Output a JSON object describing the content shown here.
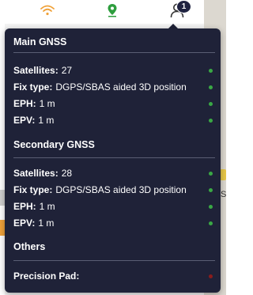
{
  "topbar": {
    "icons": {
      "wifi": "wifi-icon",
      "gps": "map-pin-icon",
      "user": "user-icon"
    },
    "notification_count": "1",
    "colors": {
      "wifi": "#f0a23a",
      "gps": "#2e9e3e"
    }
  },
  "popup": {
    "main_gnss": {
      "title": "Main GNSS",
      "rows": [
        {
          "label": "Satellites:",
          "value": "27",
          "status": "green"
        },
        {
          "label": "Fix type:",
          "value": "DGPS/SBAS aided 3D position",
          "status": "green"
        },
        {
          "label": "EPH:",
          "value": "1 m",
          "status": "green"
        },
        {
          "label": "EPV:",
          "value": "1 m",
          "status": "green"
        }
      ]
    },
    "secondary_gnss": {
      "title": "Secondary GNSS",
      "rows": [
        {
          "label": "Satellites:",
          "value": "28",
          "status": "green"
        },
        {
          "label": "Fix type:",
          "value": "DGPS/SBAS aided 3D position",
          "status": "green"
        },
        {
          "label": "EPH:",
          "value": "1 m",
          "status": "green"
        },
        {
          "label": "EPV:",
          "value": "1 m",
          "status": "green"
        }
      ]
    },
    "others": {
      "title": "Others",
      "rows": [
        {
          "label": "Precision Pad:",
          "value": "",
          "status": "red"
        }
      ]
    },
    "colors": {
      "background": "#1f2238",
      "status_green": "#3aa845",
      "status_red": "#8a1c1c"
    }
  },
  "background": {
    "map_label": "S"
  }
}
